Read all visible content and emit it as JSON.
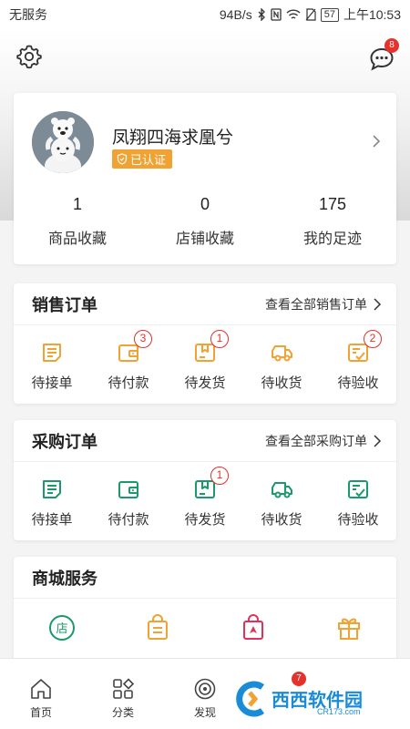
{
  "status_bar": {
    "carrier": "无服务",
    "speed": "94B/s",
    "battery": "57",
    "time": "上午10:53"
  },
  "header": {
    "message_badge": "8"
  },
  "profile": {
    "name": "凤翔四海求凰兮",
    "verified_label": "已认证"
  },
  "stats": [
    {
      "value": "1",
      "label": "商品收藏"
    },
    {
      "value": "0",
      "label": "店铺收藏"
    },
    {
      "value": "175",
      "label": "我的足迹"
    }
  ],
  "sales_orders": {
    "title": "销售订单",
    "link": "查看全部销售订单",
    "accent": "#f0a232",
    "items": [
      {
        "label": "待接单",
        "icon": "order-list-icon",
        "badge": ""
      },
      {
        "label": "待付款",
        "icon": "wallet-icon",
        "badge": "3"
      },
      {
        "label": "待发货",
        "icon": "package-icon",
        "badge": "1"
      },
      {
        "label": "待收货",
        "icon": "truck-icon",
        "badge": ""
      },
      {
        "label": "待验收",
        "icon": "check-doc-icon",
        "badge": "2"
      }
    ]
  },
  "purchase_orders": {
    "title": "采购订单",
    "link": "查看全部采购订单",
    "accent": "#1a9a6a",
    "items": [
      {
        "label": "待接单",
        "icon": "order-list-icon",
        "badge": ""
      },
      {
        "label": "待付款",
        "icon": "wallet-icon",
        "badge": ""
      },
      {
        "label": "待发货",
        "icon": "package-icon",
        "badge": "1"
      },
      {
        "label": "待收货",
        "icon": "truck-icon",
        "badge": ""
      },
      {
        "label": "待验收",
        "icon": "check-doc-icon",
        "badge": ""
      }
    ]
  },
  "mall_service": {
    "title": "商城服务",
    "items": [
      {
        "icon": "store-icon",
        "glyph": "店"
      },
      {
        "icon": "shopping-bag-icon"
      },
      {
        "icon": "location-bag-icon"
      },
      {
        "icon": "gift-icon"
      }
    ]
  },
  "tab_bar": {
    "tabs": [
      {
        "label": "首页",
        "icon": "home-icon"
      },
      {
        "label": "分类",
        "icon": "category-icon"
      },
      {
        "label": "发现",
        "icon": "discover-icon"
      }
    ],
    "cart_badge": "7"
  },
  "watermark": {
    "text": "西西软件园",
    "sub": "CR173.com"
  }
}
